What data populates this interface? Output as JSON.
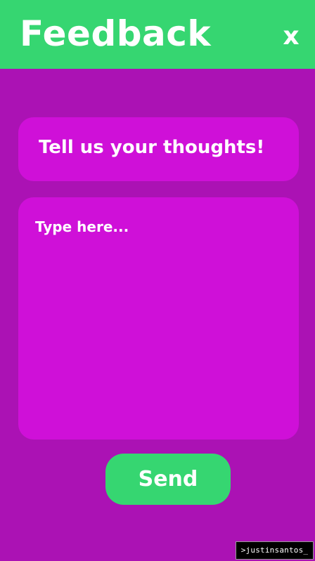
{
  "header": {
    "title": "Feedback",
    "close_label": "x"
  },
  "prompt": {
    "text": "Tell us your thoughts!"
  },
  "feedback_input": {
    "value": "",
    "placeholder": "Type here..."
  },
  "actions": {
    "send_label": "Send"
  },
  "watermark": {
    "text": ">justinsantos_"
  },
  "colors": {
    "background": "#ab12b4",
    "card": "#cf10d8",
    "accent": "#36d671",
    "text": "#ffffff"
  }
}
